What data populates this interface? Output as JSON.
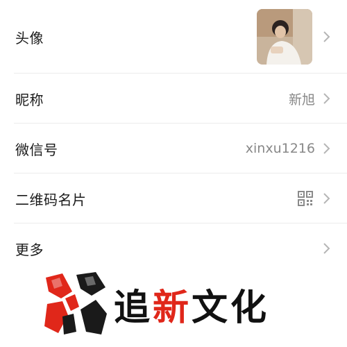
{
  "rows": [
    {
      "label": "头像"
    },
    {
      "label": "昵称",
      "value": "新旭"
    },
    {
      "label": "微信号",
      "value": "xinxu1216"
    },
    {
      "label": "二维码名片"
    },
    {
      "label": "更多"
    }
  ],
  "brand": {
    "pre": "追",
    "highlight": "新",
    "post": "文化",
    "accent_color": "#e0271a"
  },
  "icons": {
    "chevron": "chevron-right-icon",
    "qr": "qr-code-icon"
  }
}
